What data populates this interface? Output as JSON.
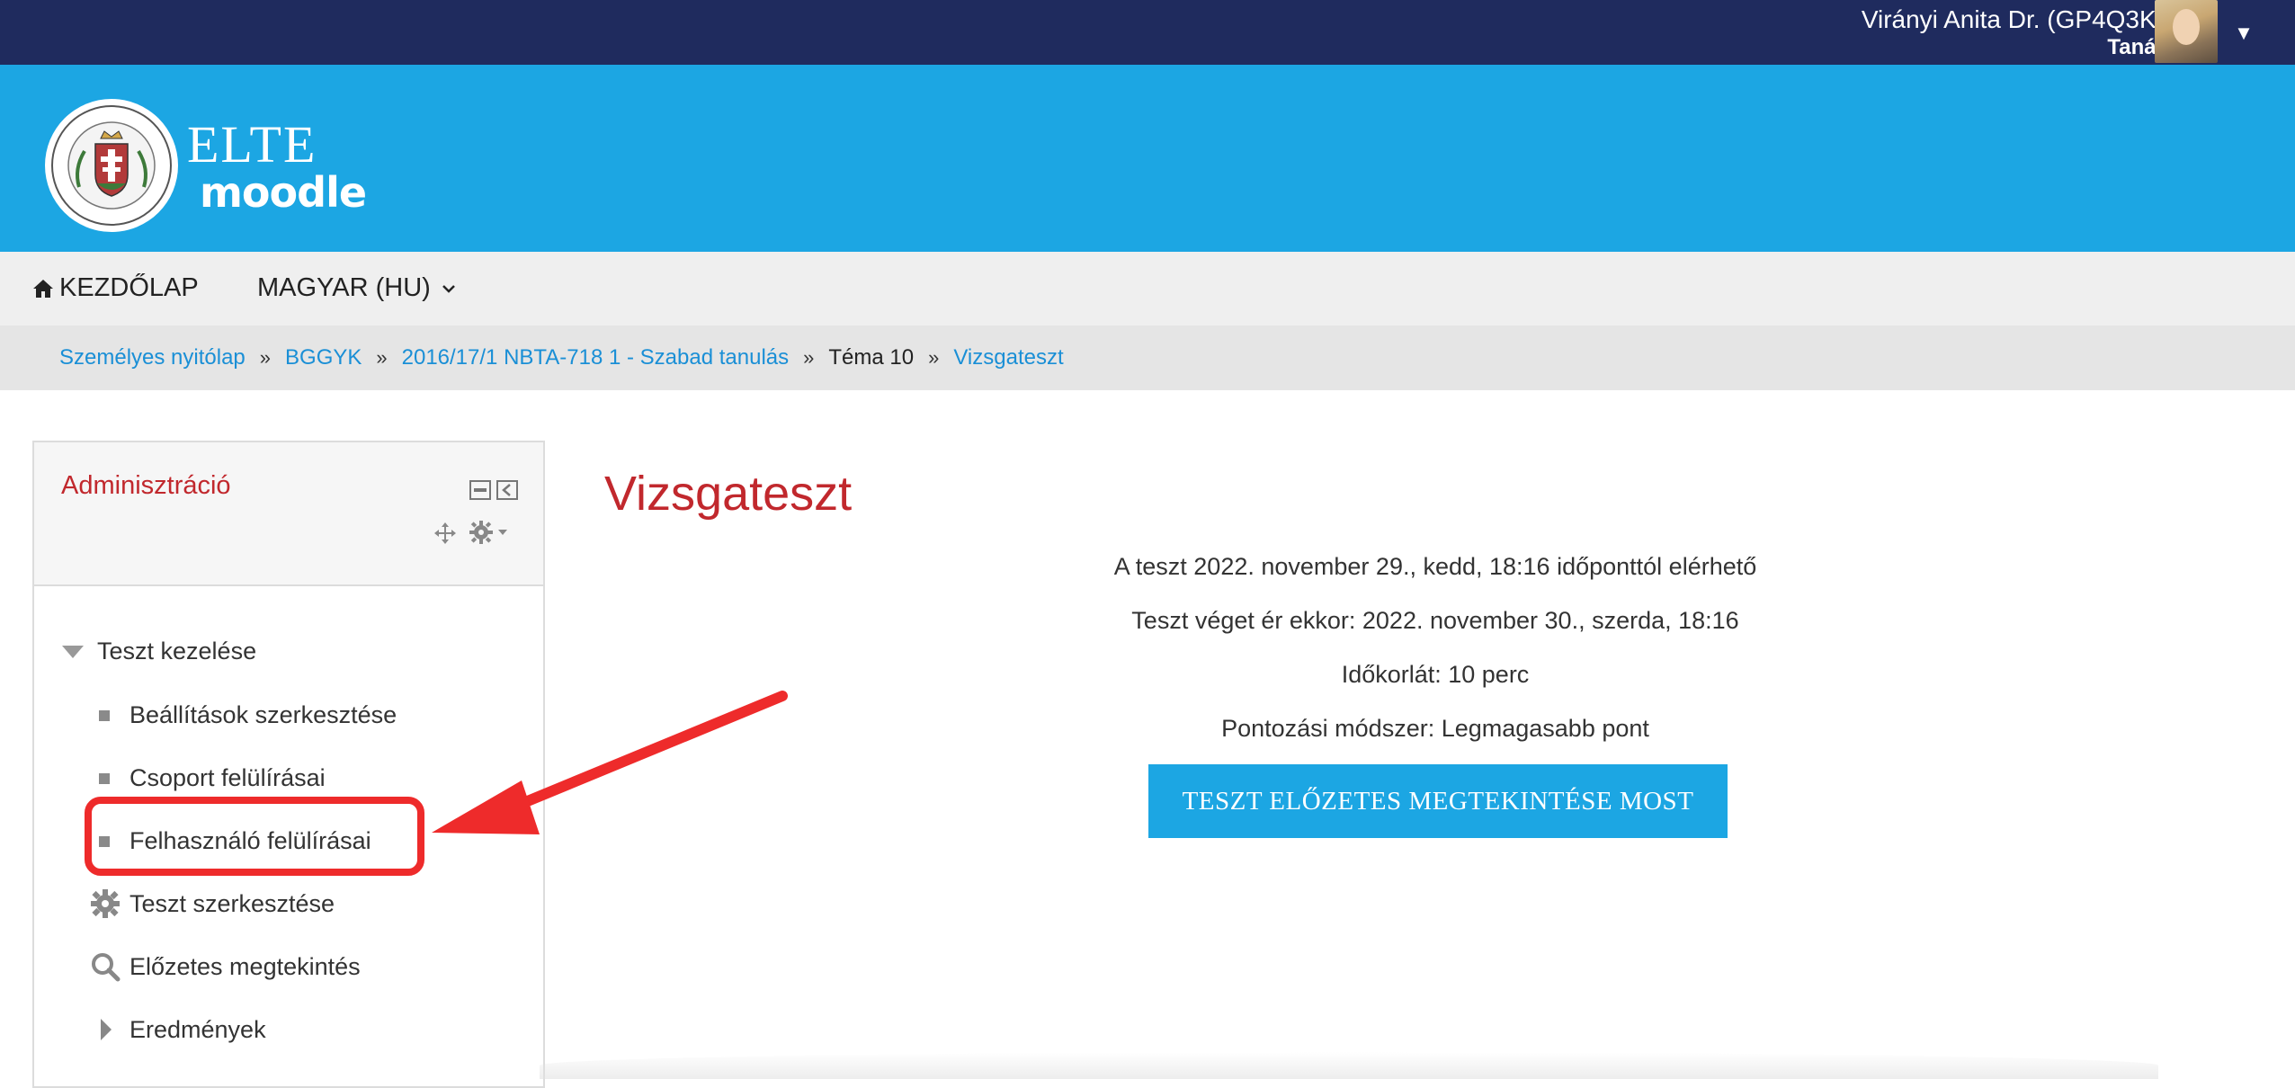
{
  "user": {
    "name": "Virányi Anita Dr. (GP4Q3K)",
    "role": "Tanár"
  },
  "brand": {
    "elte": "ELTE",
    "moodle": "moodle",
    "header_color": "#1ca6e3",
    "topbar_color": "#1f2b5e"
  },
  "nav": {
    "home_label": "KEZDŐLAP",
    "language_label": "MAGYAR (HU)"
  },
  "breadcrumb": [
    {
      "label": "Személyes nyitólap",
      "link": true
    },
    {
      "label": "BGGYK",
      "link": true
    },
    {
      "label": "2016/17/1 NBTA-718 1 - Szabad tanulás",
      "link": true
    },
    {
      "label": "Téma 10",
      "link": false
    },
    {
      "label": "Vizsgateszt",
      "link": true
    }
  ],
  "admin_block": {
    "title": "Adminisztráció",
    "items": [
      {
        "label": "Teszt kezelése",
        "icon": "triangle-down-icon"
      },
      {
        "label": "Beállítások szerkesztése",
        "icon": "bullet-icon"
      },
      {
        "label": "Csoport felülírásai",
        "icon": "bullet-icon"
      },
      {
        "label": "Felhasználó felülírásai",
        "icon": "bullet-icon",
        "highlighted": true
      },
      {
        "label": "Teszt szerkesztése",
        "icon": "gear-icon"
      },
      {
        "label": "Előzetes megtekintés",
        "icon": "search-icon"
      },
      {
        "label": "Eredmények",
        "icon": "triangle-right-icon"
      }
    ]
  },
  "main": {
    "title": "Vizsgateszt",
    "info": [
      "A teszt 2022. november 29., kedd, 18:16 időponttól elérhető",
      "Teszt véget ér ekkor: 2022. november 30., szerda, 18:16",
      "Időkorlát: 10 perc",
      "Pontozási módszer: Legmagasabb pont"
    ],
    "preview_button": "TESZT ELŐZETES MEGTEKINTÉSE MOST"
  },
  "annotation": {
    "color": "#ee2b2b"
  }
}
